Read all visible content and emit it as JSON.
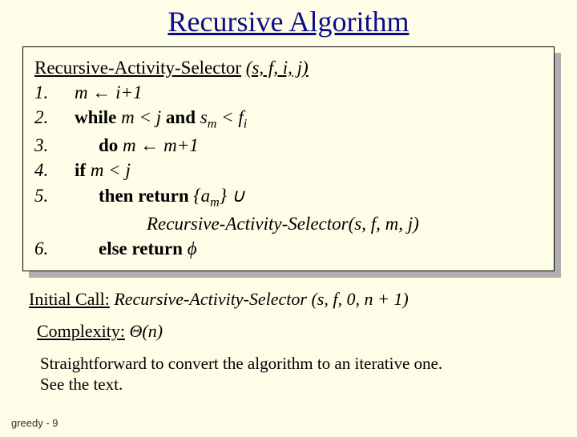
{
  "title": "Recursive Algorithm",
  "algo": {
    "name": "Recursive-Activity-Selector",
    "params": "(s, f, i, j)",
    "lines": {
      "l1n": "1.",
      "l1": "m ← i+1",
      "l2n": "2.",
      "l3n": "3.",
      "l3": "m ← m+1",
      "l4n": "4.",
      "l5n": "5.",
      "l5b": "Recursive-Activity-Selector(s, f, m, j)",
      "l6n": "6.",
      "l6": "ϕ"
    },
    "kw": {
      "while": "while",
      "and": "and",
      "do": "do",
      "if": "if",
      "then_return": "then return",
      "else_return": "else return"
    },
    "expr": {
      "mlj": "m < j",
      "smlfi_left": "s",
      "smlfi_sub1": "m",
      "smlfi_mid": " < f",
      "smlfi_sub2": "i",
      "set_open": "{a",
      "set_sub": "m",
      "set_close": "} ∪"
    }
  },
  "initial": {
    "label": "Initial Call:",
    "text": " Recursive-Activity-Selector (s, f, 0, n + 1)"
  },
  "complexity": {
    "label": "Complexity:",
    "text": " Θ(n)"
  },
  "note_l1": "Straightforward to convert the algorithm to an iterative one.",
  "note_l2": "See the text.",
  "footer": "greedy - 9"
}
